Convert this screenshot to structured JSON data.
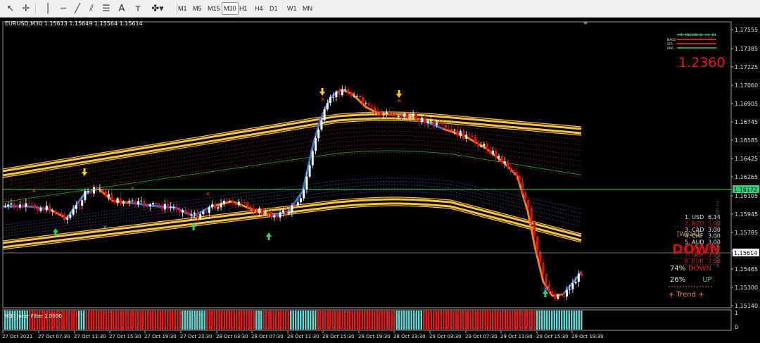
{
  "toolbar": {
    "tools": [
      {
        "name": "cursor-icon",
        "glyph": "↖"
      },
      {
        "name": "crosshair-icon",
        "glyph": "✛"
      },
      {
        "name": "vertical-line-icon",
        "glyph": "│"
      },
      {
        "name": "horizontal-line-icon",
        "glyph": "─"
      },
      {
        "name": "trendline-icon",
        "glyph": "╱"
      },
      {
        "name": "channel-icon",
        "glyph": "⫽"
      },
      {
        "name": "fibonacci-icon",
        "glyph": "☰"
      },
      {
        "name": "text-icon",
        "glyph": "A"
      },
      {
        "name": "text-label-icon",
        "glyph": "ᴛ"
      },
      {
        "name": "shapes-dropdown-icon",
        "glyph": "✤▾"
      }
    ],
    "timeframes": [
      "M1",
      "M5",
      "M15",
      "M30",
      "H1",
      "H4",
      "D1",
      "W1",
      "MN"
    ],
    "active_timeframe": "M30"
  },
  "chart": {
    "symbol_info": "EURUSD,M30  1.15613 1.15649 1.15564 1.15614",
    "big_price": "1.2360",
    "current_price_label": "1.15614",
    "line_price_label": "1.16172",
    "price_scale": [
      "1.17555",
      "1.17385",
      "1.17225",
      "1.17060",
      "1.16905",
      "1.16745",
      "1.16585",
      "1.16425",
      "1.16265",
      "1.16105",
      "1.15945",
      "1.15785",
      "1.15625",
      "1.15465",
      "1.15300",
      "1.15140"
    ],
    "time_axis": [
      "27 Oct 2021",
      "27 Oct 07:30",
      "27 Oct 11:30",
      "27 Oct 15:30",
      "27 Oct 19:30",
      "27 Oct 23:30",
      "28 Oct 03:30",
      "28 Oct 07:30",
      "28 Oct 11:30",
      "28 Oct 15:30",
      "28 Oct 19:30",
      "28 Oct 23:30",
      "29 Oct 03:30",
      "29 Oct 07:30",
      "29 Oct 11:30",
      "29 Oct 15:30",
      "29 Oct 19:30"
    ],
    "mini_table": {
      "headers": [
        "M5",
        "M15",
        "M30",
        "H1",
        "H4",
        "D1"
      ],
      "rows": [
        "MACD",
        "STR",
        "EMA"
      ]
    },
    "currency_strength": [
      {
        "label": "1. USD",
        "value": "6.14",
        "color": "#dddddd"
      },
      {
        "label": "2. NZD",
        "value": "5.00",
        "color": "#cc2020"
      },
      {
        "label": "3. CAD",
        "value": "3.00",
        "color": "#e0e0e0"
      },
      {
        "label": "4. CHF",
        "value": "3.00",
        "color": "#e0e0e0"
      },
      {
        "label": "5. AUD",
        "value": "3.00",
        "color": "#e0e0e0"
      },
      {
        "label": "6. JPY",
        "value": "2.00",
        "color": "#cc2020"
      },
      {
        "label": "7. GBP",
        "value": "2.00",
        "color": "#cc2020"
      },
      {
        "label": "8. EUR",
        "value": "2.00",
        "color": "#cc2020"
      }
    ],
    "trend_overlay_text": "DOWN",
    "weak_text": "[Weak]",
    "watermark": "www.forex-trading-team.ru",
    "down_pct": "74%",
    "down_label": "DOWN",
    "up_pct": "26%",
    "up_label": "UP",
    "trend_label": "+ Trend +",
    "subwindow_label": "M30 Joker Filter  1.0000",
    "subwindow_scale": [
      "1",
      "0"
    ],
    "colors": {
      "background": "#000000",
      "bull_candle": "#ffffff",
      "bear_candle": "#e01010",
      "band_outer": "#f5c242",
      "ma_up": "#3a6fd8",
      "ma_down": "#ff7a1a",
      "histogram_up": "#5fd5d0",
      "histogram_down": "#dc1c1c"
    }
  }
}
